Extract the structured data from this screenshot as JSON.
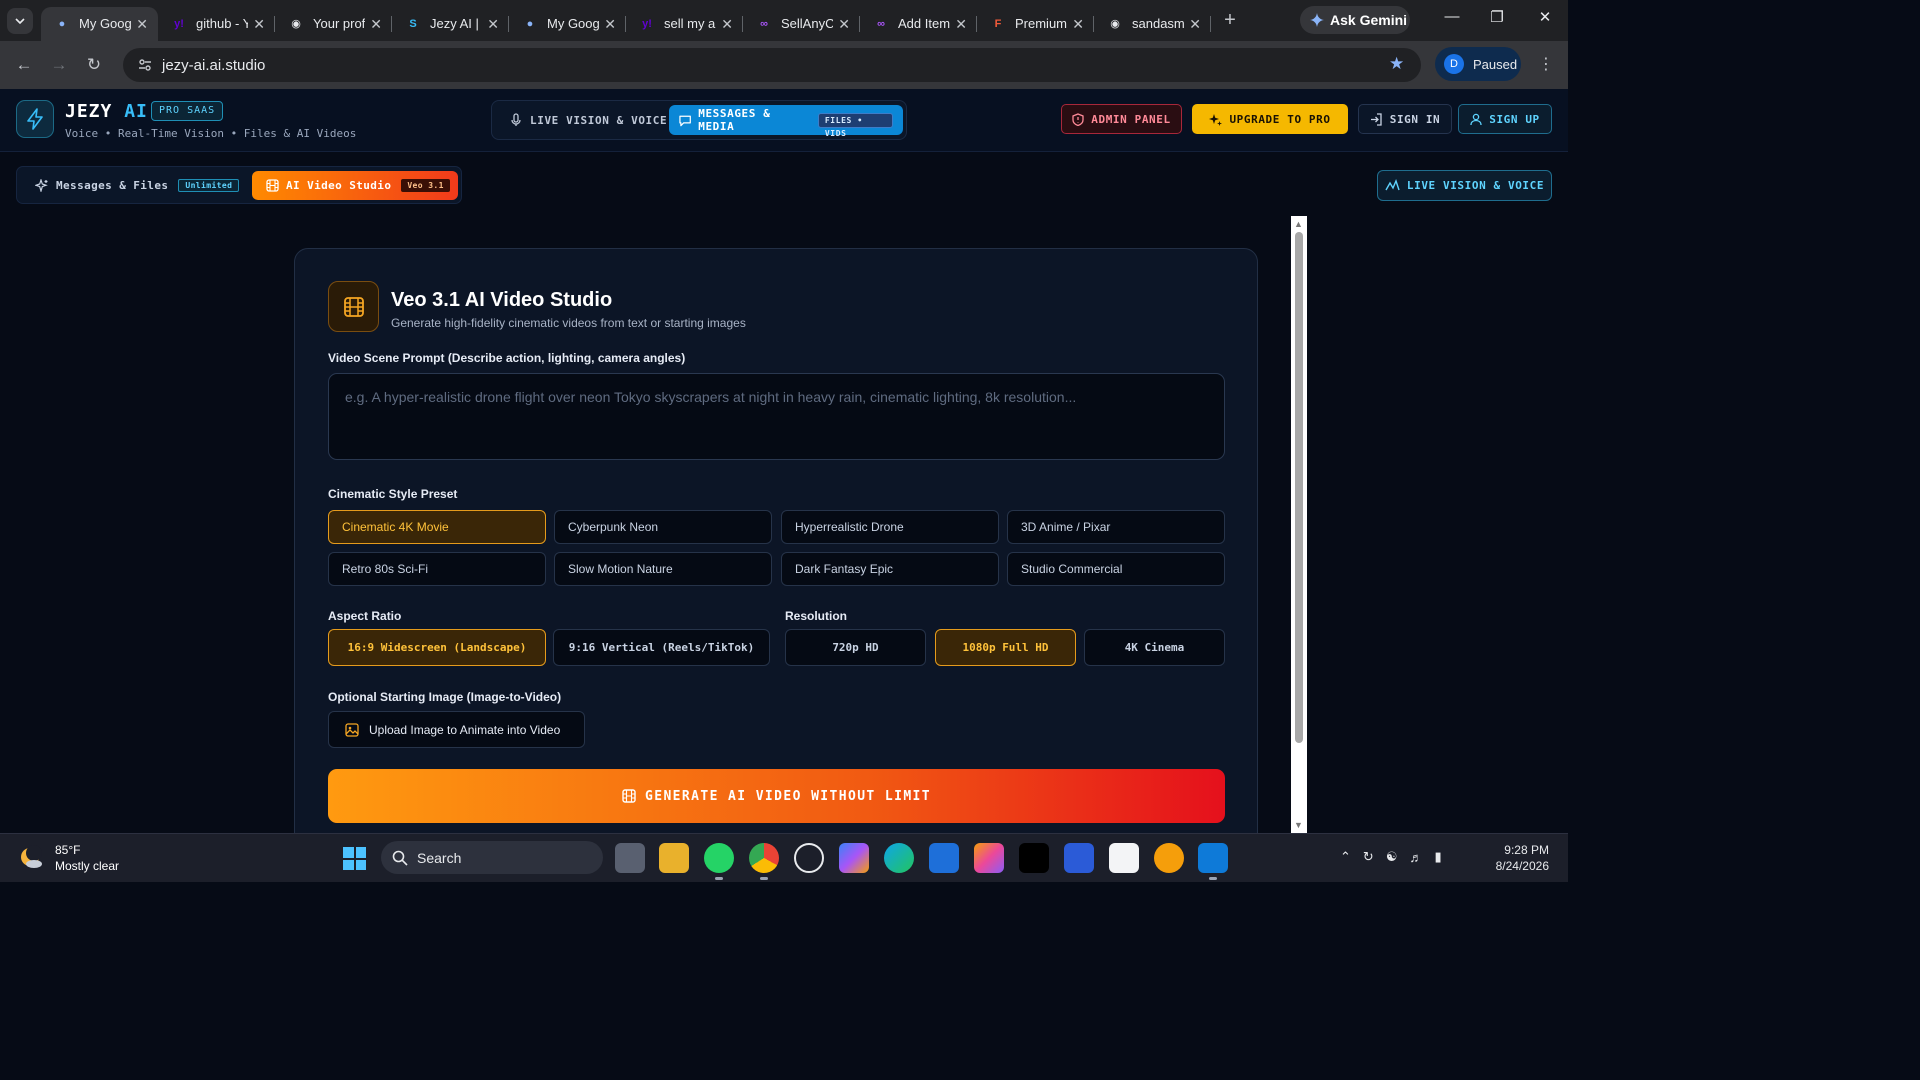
{
  "browser": {
    "tabs": [
      {
        "title": "My Google",
        "favicon": "globe-icon",
        "active": true
      },
      {
        "title": "github - Yahoo",
        "favicon": "yahoo-icon",
        "active": false
      },
      {
        "title": "Your profile",
        "favicon": "github-icon",
        "active": false
      },
      {
        "title": "Jezy AI | Pro",
        "favicon": "jezy-icon",
        "active": false
      },
      {
        "title": "My Google",
        "favicon": "globe-icon",
        "active": false
      },
      {
        "title": "sell my app",
        "favicon": "yahoo-icon",
        "active": false
      },
      {
        "title": "SellAnyCode",
        "favicon": "sellany-icon",
        "active": false
      },
      {
        "title": "Add Item",
        "favicon": "sellany-icon",
        "active": false
      },
      {
        "title": "Premium",
        "favicon": "f-icon",
        "active": false
      },
      {
        "title": "sandasm",
        "favicon": "github-icon",
        "active": false
      }
    ],
    "gemini_label": "Ask Gemini",
    "url": "jezy-ai.ai.studio",
    "profile_initial": "D",
    "profile_status": "Paused"
  },
  "app": {
    "brand": "JEZY",
    "brand_accent": "AI",
    "badge": "PRO SAAS",
    "tagline": "Voice • Real-Time Vision • Files & AI Videos",
    "modes": {
      "live": "LIVE VISION & VOICE",
      "messages": "MESSAGES & MEDIA",
      "messages_badge": "FILES • VIDS"
    },
    "header_buttons": {
      "admin": "ADMIN PANEL",
      "upgrade": "UPGRADE TO PRO",
      "sign_in": "SIGN IN",
      "sign_up": "SIGN UP"
    },
    "subtabs": {
      "messages": "Messages & Files",
      "messages_badge": "Unlimited",
      "video": "AI Video Studio",
      "video_badge": "Veo 3.1"
    },
    "live_button": "LIVE VISION & VOICE",
    "accent_color": "#f5b800",
    "primary_color": "#0b87d6"
  },
  "studio": {
    "title": "Veo 3.1 AI Video Studio",
    "subtitle": "Generate high-fidelity cinematic videos from text or starting images",
    "prompt_label": "Video Scene Prompt (Describe action, lighting, camera angles)",
    "prompt_placeholder": "e.g. A hyper-realistic drone flight over neon Tokyo skyscrapers at night in heavy rain, cinematic lighting, 8k resolution...",
    "prompt_value": "",
    "style_label": "Cinematic Style Preset",
    "styles": [
      "Cinematic 4K Movie",
      "Cyberpunk Neon",
      "Hyperrealistic Drone",
      "3D Anime / Pixar",
      "Retro 80s Sci-Fi",
      "Slow Motion Nature",
      "Dark Fantasy Epic",
      "Studio Commercial"
    ],
    "selected_style": "Cinematic 4K Movie",
    "aspect_label": "Aspect Ratio",
    "aspects": [
      "16:9 Widescreen (Landscape)",
      "9:16 Vertical (Reels/TikTok)"
    ],
    "selected_aspect": "16:9 Widescreen (Landscape)",
    "resolution_label": "Resolution",
    "resolutions": [
      "720p HD",
      "1080p Full HD",
      "4K Cinema"
    ],
    "selected_resolution": "1080p Full HD",
    "image_label": "Optional Starting Image (Image-to-Video)",
    "upload_label": "Upload Image to Animate into Video",
    "generate_label": "GENERATE AI VIDEO WITHOUT LIMIT"
  },
  "taskbar": {
    "temperature": "85°F",
    "weather": "Mostly clear",
    "search_label": "Search",
    "time": "9:28 PM",
    "date": "8/24/2026"
  }
}
